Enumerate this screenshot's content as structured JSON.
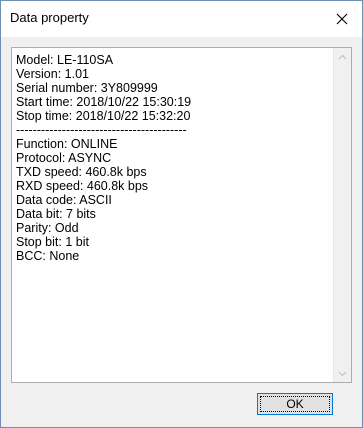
{
  "window": {
    "title": "Data property",
    "close_icon": "close-icon"
  },
  "content": {
    "lines": [
      "Model: LE-110SA",
      "Version: 1.01",
      "Serial number: 3Y809999",
      "Start time: 2018/10/22 15:30:19",
      "Stop time: 2018/10/22 15:32:20",
      "-----------------------------------------",
      "Function: ONLINE",
      "Protocol: ASYNC",
      "TXD speed: 460.8k bps",
      "RXD speed: 460.8k bps",
      "Data code: ASCII",
      "Data bit: 7 bits",
      "Parity: Odd",
      "Stop bit: 1 bit",
      "BCC: None"
    ]
  },
  "buttons": {
    "ok_label": "OK"
  }
}
